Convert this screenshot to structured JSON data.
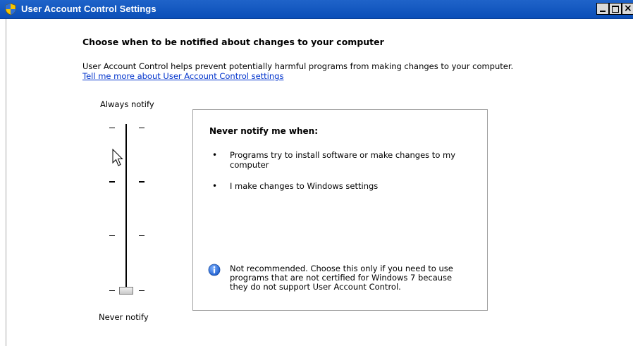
{
  "window": {
    "title": "User Account Control Settings",
    "icon": "uac-shield-icon",
    "controls": {
      "minimize": "minimize-button",
      "maximize": "maximize-button",
      "close": "×"
    }
  },
  "main": {
    "heading": "Choose when to be notified about changes to your computer",
    "description": "User Account Control helps prevent potentially harmful programs from making changes to your computer.",
    "link": "Tell me more about User Account Control settings"
  },
  "slider": {
    "top_label": "Always notify",
    "bottom_label": "Never notify",
    "levels": 4,
    "selected_level": 0
  },
  "panel": {
    "title": "Never notify me when:",
    "bullets": [
      "Programs try to install software or make changes to my computer",
      "I make changes to Windows settings"
    ],
    "bullet_glyph": "•",
    "info_text": "Not recommended. Choose this only if you need to use programs that are not certified for Windows 7 because they do not support User Account Control.",
    "info_icon": "info-icon"
  },
  "colors": {
    "titlebar": "#0b4fb8",
    "link": "#0033cc",
    "info_icon_blue": "#2f6fd6"
  }
}
